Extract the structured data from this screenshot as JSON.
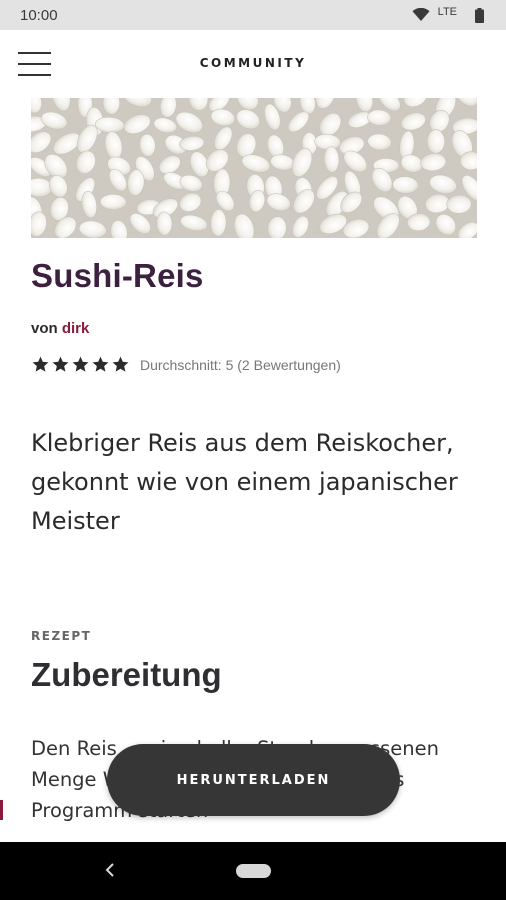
{
  "status_bar": {
    "time": "10:00",
    "network": "LTE",
    "icons": [
      "wifi-icon",
      "signal-icon",
      "battery-icon"
    ]
  },
  "app_bar": {
    "title": "COMMUNITY",
    "menu_icon": "hamburger-menu-icon"
  },
  "recipe": {
    "image": "sushi-rice-photo",
    "title": "Sushi-Reis",
    "author_prefix": "von",
    "author": "dirk",
    "rating": {
      "value": 5,
      "max": 5,
      "text": "Durchschnitt: 5 (2 Bewertungen)"
    },
    "description": "Klebriger Reis aus dem Reiskocher, gekonnt wie von einem japanischer Meister"
  },
  "section": {
    "kicker": "REZEPT",
    "title": "Zubereitung",
    "body": "Den Reis … eine halbe Stunde … essenen Menge W… Deckel schliessen und das Programm starten"
  },
  "download_button": {
    "label": "HERUNTERLADEN"
  },
  "nav_bar": {
    "icons": [
      "back-icon",
      "home-pill-icon"
    ]
  },
  "colors": {
    "title": "#3d1f3f",
    "author": "#8b1b3c",
    "button": "#363636",
    "status_bar": "#e3e3e3"
  }
}
